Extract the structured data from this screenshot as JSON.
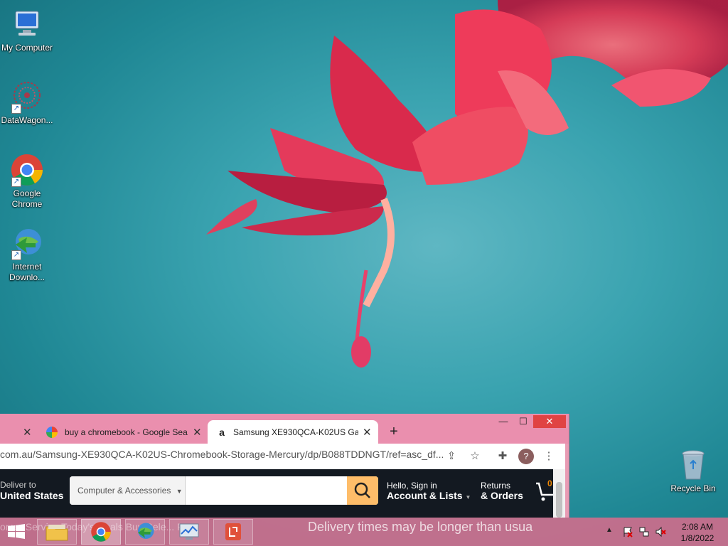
{
  "desktop": {
    "icons": [
      {
        "label": "My Computer"
      },
      {
        "label": "DataWagon..."
      },
      {
        "label": "Google Chrome"
      },
      {
        "label": "Internet Downlo..."
      },
      {
        "label": "Recycle Bin"
      }
    ]
  },
  "browser": {
    "tabs": [
      {
        "title": "buy a chromebook - Google Sea"
      },
      {
        "title": "Samsung XE930QCA-K02US Gala"
      }
    ],
    "new_tab": "+",
    "controls": {
      "minimize": "—",
      "maximize": "☐",
      "close": "✕"
    },
    "url": "com.au/Samsung-XE930QCA-K02US-Chromebook-Storage-Mercury/dp/B088TDDNGT/ref=asc_df...",
    "profile_initial": "?"
  },
  "amazon": {
    "deliver_line1": "Deliver to",
    "deliver_line2": "United States",
    "search_category": "Computer & Accessories",
    "search_placeholder": "",
    "account_line1": "Hello, Sign in",
    "account_line2": "Account & Lists",
    "returns_line1": "Returns",
    "returns_line2": "& Orders"
  },
  "taskbar": {
    "ghost_text": "omer Service  Today's Deals  Buy Rele...  Pr...",
    "delivery_banner": "Delivery times may be longer than usua",
    "clock_time": "2:08 AM",
    "clock_date": "1/8/2022"
  },
  "colors": {
    "amazon_nav": "#131921",
    "search_button": "#febd69",
    "taskbar": "#cd6e8c"
  }
}
